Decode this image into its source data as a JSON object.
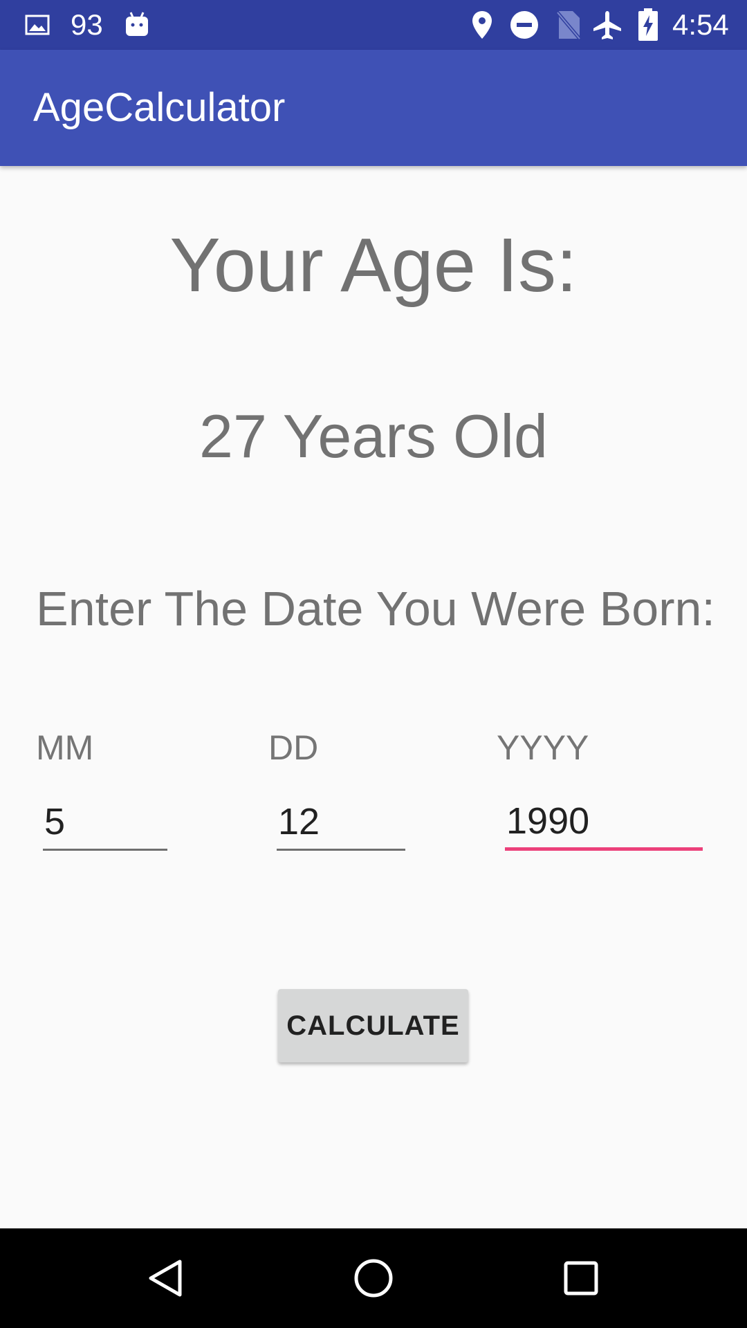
{
  "status_bar": {
    "notification_count": "93",
    "time": "4:54",
    "icons": [
      "image-icon",
      "android-icon",
      "location-icon",
      "do-not-disturb-icon",
      "no-sim-icon",
      "airplane-mode-icon",
      "battery-charging-icon"
    ]
  },
  "app_bar": {
    "title": "AgeCalculator"
  },
  "main": {
    "age_heading": "Your Age Is:",
    "age_result": "27 Years Old",
    "prompt": "Enter The Date You Were Born:",
    "fields": {
      "month": {
        "label": "MM",
        "value": "5"
      },
      "day": {
        "label": "DD",
        "value": "12"
      },
      "year": {
        "label": "YYYY",
        "value": "1990"
      }
    },
    "calculate_label": "CALCULATE"
  },
  "colors": {
    "status_bar": "#303f9f",
    "app_bar": "#3f51b5",
    "accent": "#ec407a",
    "text_secondary": "#727272"
  },
  "nav_bar": {
    "icons": [
      "back-icon",
      "home-icon",
      "recents-icon"
    ]
  }
}
